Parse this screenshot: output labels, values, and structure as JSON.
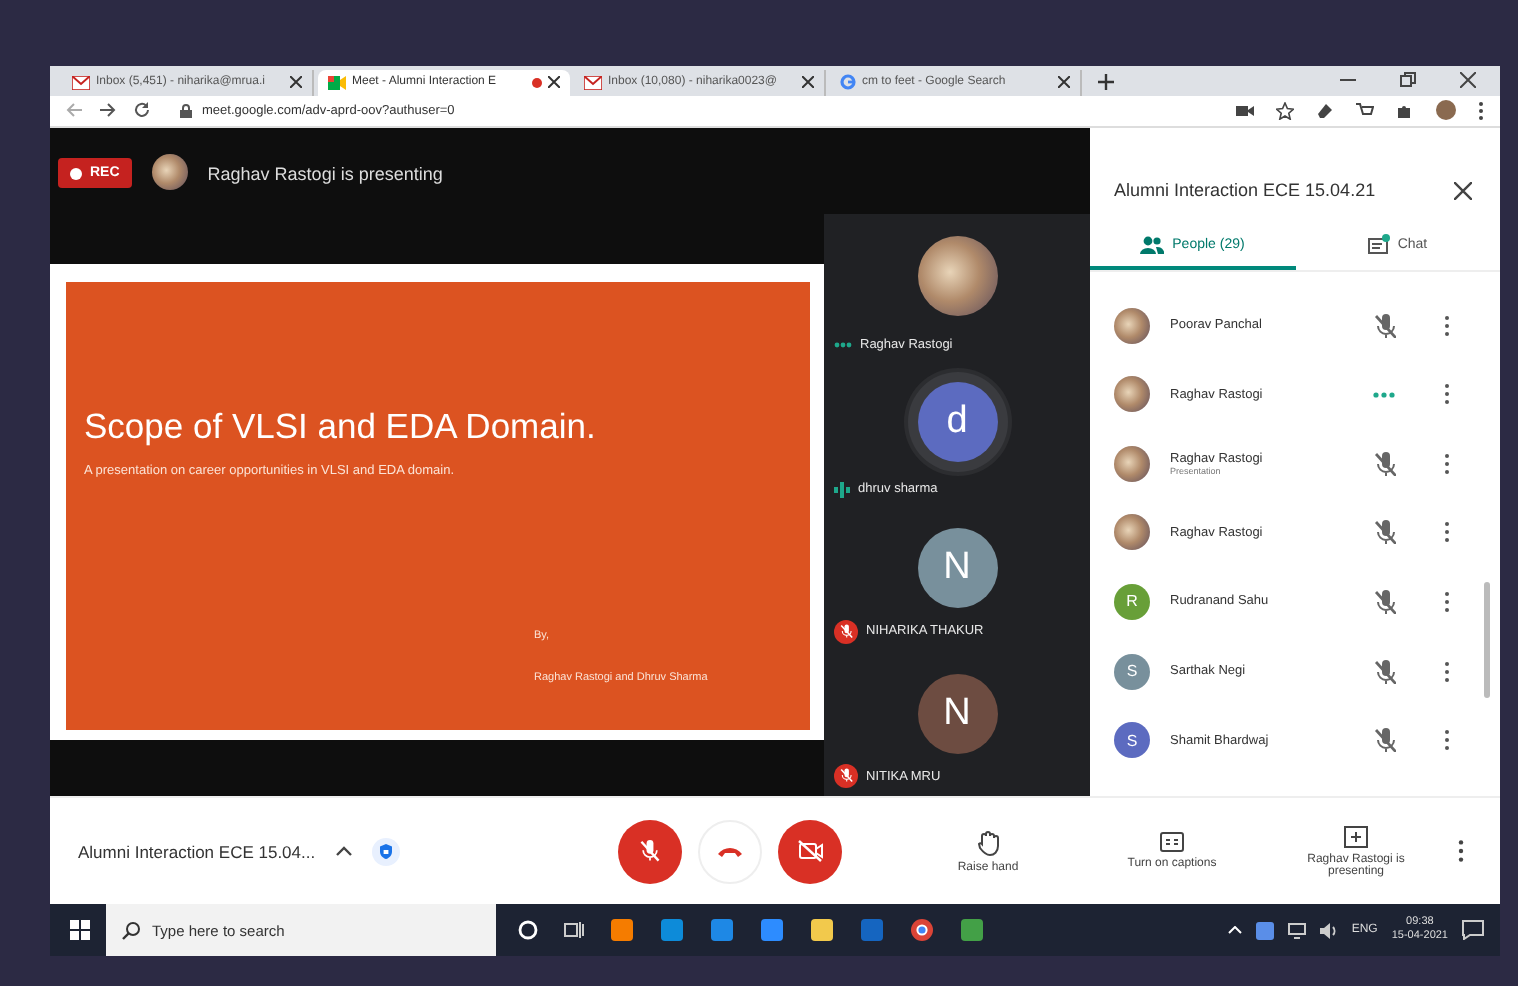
{
  "browser": {
    "tabs": [
      {
        "title": "Inbox (5,451) - niharika@mrua.i",
        "kind": "mail",
        "selected": false,
        "recording": false
      },
      {
        "title": "Meet - Alumni Interaction E",
        "kind": "meet",
        "selected": true,
        "recording": true
      },
      {
        "title": "Inbox (10,080) - niharika0023@",
        "kind": "mail",
        "selected": false,
        "recording": false
      },
      {
        "title": "cm to feet - Google Search",
        "kind": "search",
        "selected": false,
        "recording": false
      }
    ],
    "address": "meet.google.com/adv-aprd-oov?authuser=0"
  },
  "meeting": {
    "recording_label": "REC",
    "presenter_banner": "Raghav Rastogi is presenting",
    "slide": {
      "title": "Scope of VLSI and EDA Domain.",
      "subtitle": "A presentation on career opportunities in VLSI and EDA domain.",
      "by": "By,",
      "authors": "Raghav Rastogi  and Dhruv Sharma"
    },
    "tiles": [
      {
        "name": "Raghav Rastogi",
        "kind": "photo",
        "muted": false,
        "speaking": false
      },
      {
        "name": "dhruv sharma",
        "kind": "letter",
        "letter": "d",
        "color": "#5c6bc0",
        "muted": false,
        "speaking": true
      },
      {
        "name": "NIHARIKA THAKUR",
        "kind": "letter",
        "letter": "N",
        "color": "#78909c",
        "muted": true,
        "speaking": false
      },
      {
        "name": "NITIKA MRU",
        "kind": "letter",
        "letter": "N",
        "color": "#6d4c41",
        "muted": true,
        "speaking": false
      }
    ]
  },
  "side_panel": {
    "title": "Alumni Interaction ECE 15.04.21",
    "tabs": [
      {
        "label": "People (29)",
        "kind": "people",
        "selected": true,
        "unread": false
      },
      {
        "label": "Chat",
        "kind": "chat",
        "selected": false,
        "unread": true
      }
    ],
    "participants": [
      {
        "name": "Poorav Panchal",
        "kind": "photo",
        "muted": true
      },
      {
        "name": "Raghav Rastogi",
        "kind": "photo",
        "muted": false
      },
      {
        "name": "Raghav Rastogi",
        "subtitle": "Presentation",
        "kind": "photo",
        "muted": true
      },
      {
        "name": "Raghav Rastogi",
        "kind": "photo",
        "muted": true
      },
      {
        "name": "Rudranand Sahu",
        "kind": "letter",
        "letter": "R",
        "color": "#689f38",
        "muted": true
      },
      {
        "name": "Sarthak Negi",
        "kind": "letter",
        "letter": "S",
        "color": "#78909c",
        "muted": true
      },
      {
        "name": "Shamit Bhardwaj",
        "kind": "letter",
        "letter": "S",
        "color": "#5c6bc0",
        "muted": true
      }
    ]
  },
  "controls": {
    "meeting_name": "Alumni Interaction ECE 15.04...",
    "mic_on": false,
    "camera_on": false,
    "actions": [
      {
        "kind": "hand",
        "label": "Raise hand"
      },
      {
        "kind": "captions",
        "label": "Turn on captions"
      },
      {
        "kind": "present",
        "label": "Raghav Rastogi is presenting"
      }
    ]
  },
  "taskbar": {
    "search_placeholder": "Type here to search",
    "language": "ENG",
    "time": "09:38",
    "date": "15-04-2021"
  }
}
